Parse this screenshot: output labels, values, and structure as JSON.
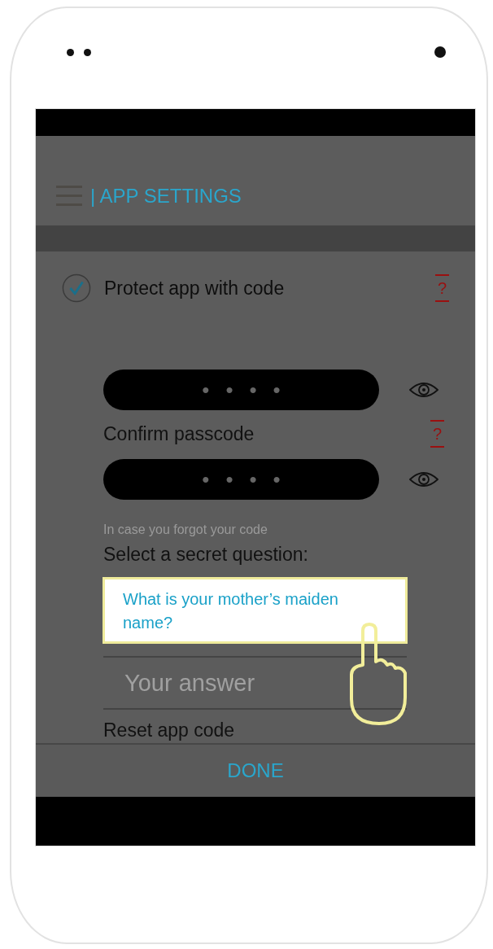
{
  "header": {
    "title": "| APP SETTINGS"
  },
  "protect": {
    "label": "Protect app with code",
    "checked": true,
    "help": "?"
  },
  "passcode": {
    "value": "••••"
  },
  "confirm": {
    "label": "Confirm passcode",
    "help": "?",
    "value": "••••"
  },
  "recovery": {
    "hint": "In case you forgot your code",
    "prompt": "Select a secret question:",
    "question": "What is your mother’s maiden name?",
    "answer_placeholder": "Your answer"
  },
  "reset_label": "Reset app code",
  "done_button": "DONE"
}
